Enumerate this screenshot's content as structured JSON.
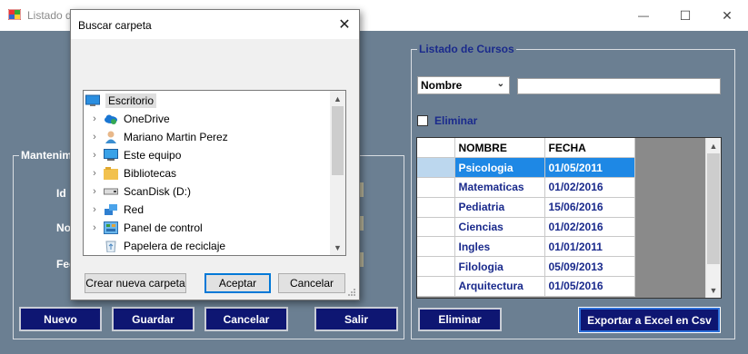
{
  "window": {
    "title": "Listado d",
    "minimize_glyph": "—",
    "maximize_glyph": "☐",
    "close_glyph": "✕"
  },
  "left_group": {
    "legend": "Mantenim",
    "labels": [
      "Id",
      "No",
      "Fec"
    ]
  },
  "bottom_buttons": {
    "nuevo": "Nuevo",
    "guardar": "Guardar",
    "cancelar": "Cancelar",
    "salir": "Salir",
    "eliminar": "Eliminar",
    "exportar": "Exportar a Excel en Csv"
  },
  "listado": {
    "legend": "Listado de Cursos",
    "filter_select": "Nombre",
    "search_value": "",
    "eliminar_checkbox": "Eliminar",
    "columns": [
      "NOMBRE",
      "FECHA"
    ],
    "rows": [
      [
        "Psicologia",
        "01/05/2011"
      ],
      [
        "Matematicas",
        "01/02/2016"
      ],
      [
        "Pediatria",
        "15/06/2016"
      ],
      [
        "Ciencias",
        "01/02/2016"
      ],
      [
        "Ingles",
        "01/01/2011"
      ],
      [
        "Filologia",
        "05/09/2013"
      ],
      [
        "Arquitectura",
        "01/05/2016"
      ]
    ]
  },
  "dialog": {
    "title": "Buscar carpeta",
    "close_glyph": "✕",
    "tree": [
      {
        "label": "Escritorio",
        "icon": "desktop-icon"
      },
      {
        "label": "OneDrive",
        "icon": "onedrive-icon"
      },
      {
        "label": "Mariano Martin Perez",
        "icon": "user-icon"
      },
      {
        "label": "Este equipo",
        "icon": "computer-icon"
      },
      {
        "label": "Bibliotecas",
        "icon": "libraries-icon"
      },
      {
        "label": "ScanDisk (D:)",
        "icon": "drive-icon"
      },
      {
        "label": "Red",
        "icon": "network-icon"
      },
      {
        "label": "Panel de control",
        "icon": "control-panel-icon"
      },
      {
        "label": "Papelera de reciclaje",
        "icon": "recycle-bin-icon"
      }
    ],
    "buttons": {
      "new_folder": "Crear nueva carpeta",
      "accept": "Aceptar",
      "cancel": "Cancelar"
    }
  },
  "colors": {
    "background": "#6b7f92",
    "navy_button": "#0e1672",
    "selection": "#1e88e5",
    "legend_text": "#1a2a8c"
  }
}
